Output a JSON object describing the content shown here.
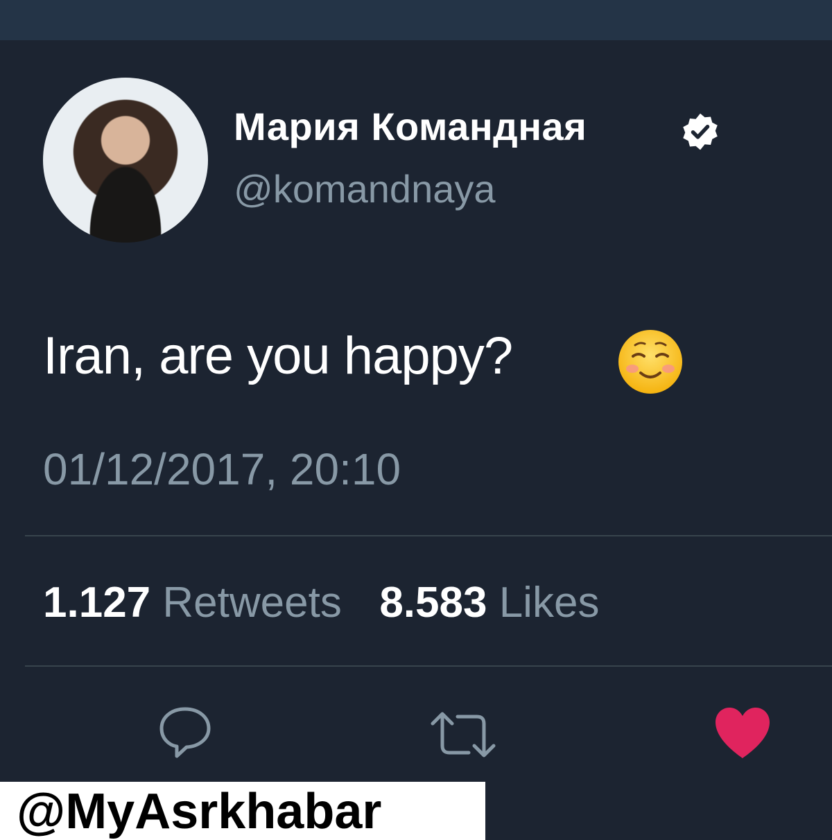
{
  "profile": {
    "name": "Мария Командная",
    "handle": "@komandnaya",
    "verified_icon": "verified-badge-icon"
  },
  "tweet": {
    "text": "Iran, are you happy?",
    "emoji": "smiling-face-emoji",
    "timestamp": "01/12/2017, 20:10"
  },
  "stats": {
    "retweets_count": "1.127",
    "retweets_label": "Retweets",
    "likes_count": "8.583",
    "likes_label": "Likes"
  },
  "actions": {
    "reply_icon": "reply-icon",
    "retweet_icon": "retweet-icon",
    "like_icon": "heart-icon",
    "like_color": "#e0245e"
  },
  "watermark": {
    "text": "@MyAsrkhabar"
  },
  "colors": {
    "background": "#1c2431",
    "secondary_text": "#8899a6",
    "divider": "#38444d"
  }
}
